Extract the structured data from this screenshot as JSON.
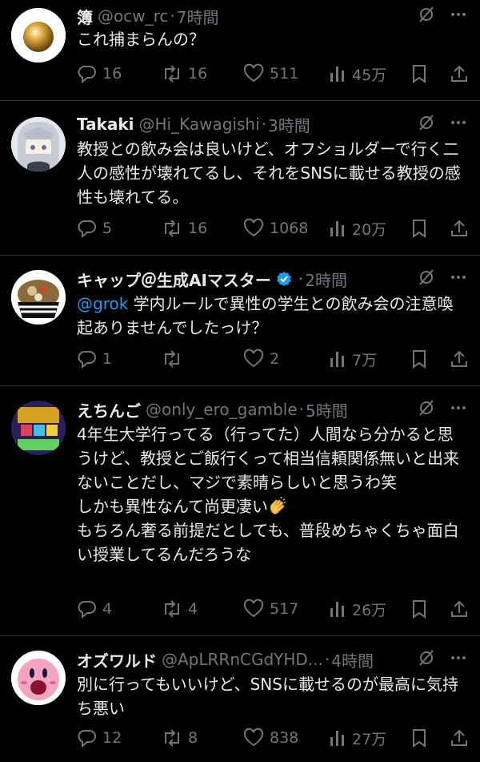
{
  "tweets": [
    {
      "name": "簿",
      "handle": "@ocw_rc",
      "time": "7時間",
      "text": "これ捕まらんの？",
      "replies": "16",
      "retweets": "16",
      "likes": "511",
      "views": "45万"
    },
    {
      "name": "Takaki",
      "handle": "@Hi_Kawagishi",
      "time": "3時間",
      "text": "教授との飲み会は良いけど、オフショルダーで行く二人の感性が壊れてるし、それをSNSに載せる教授の感性も壊れてる。",
      "replies": "5",
      "retweets": "16",
      "likes": "1068",
      "views": "20万"
    },
    {
      "name": "キャップ＠生成AIマスター",
      "handle": "",
      "time": "2時間",
      "mention": "@grok",
      "text": " 学内ルールで異性の学生との飲み会の注意喚起ありませんでしたっけ？",
      "replies": "1",
      "retweets": "",
      "likes": "2",
      "views": "7万"
    },
    {
      "name": "えちんご",
      "handle": "@only_ero_gamble",
      "time": "5時間",
      "text": "4年生大学行ってる（行ってた）人間なら分かると思うけど、教授とご飯行くって相当信頼関係無いと出来ないことだし、マジで素晴らしいと思うわ笑\nしかも異性なんて尚更凄い",
      "text2": "もちろん奢る前提だとしても、普段めちゃくちゃ面白い授業してるんだろうな",
      "replies": "4",
      "retweets": "4",
      "likes": "517",
      "views": "26万"
    },
    {
      "name": "オズワルド",
      "handle": "@ApLRRnCGdYHD...",
      "time": "4時間",
      "text": "別に行ってもいいけど、SNSに載せるのが最高に気持ち悪い",
      "replies": "12",
      "retweets": "8",
      "likes": "838",
      "views": "27万"
    }
  ],
  "dot": "·",
  "icons": {
    "reply": "reply-icon",
    "retweet": "retweet-icon",
    "like": "heart-icon",
    "views": "views-icon",
    "bookmark": "bookmark-icon",
    "share": "share-icon",
    "grok": "grok-icon",
    "more": "more-icon",
    "verified": "verified-badge-icon",
    "clap": "clapping-hands-emoji"
  },
  "colors": {
    "background": "#000000",
    "text": "#e7e9ea",
    "muted": "#71767b",
    "link": "#1d9bf0",
    "divider": "#2f3336"
  }
}
